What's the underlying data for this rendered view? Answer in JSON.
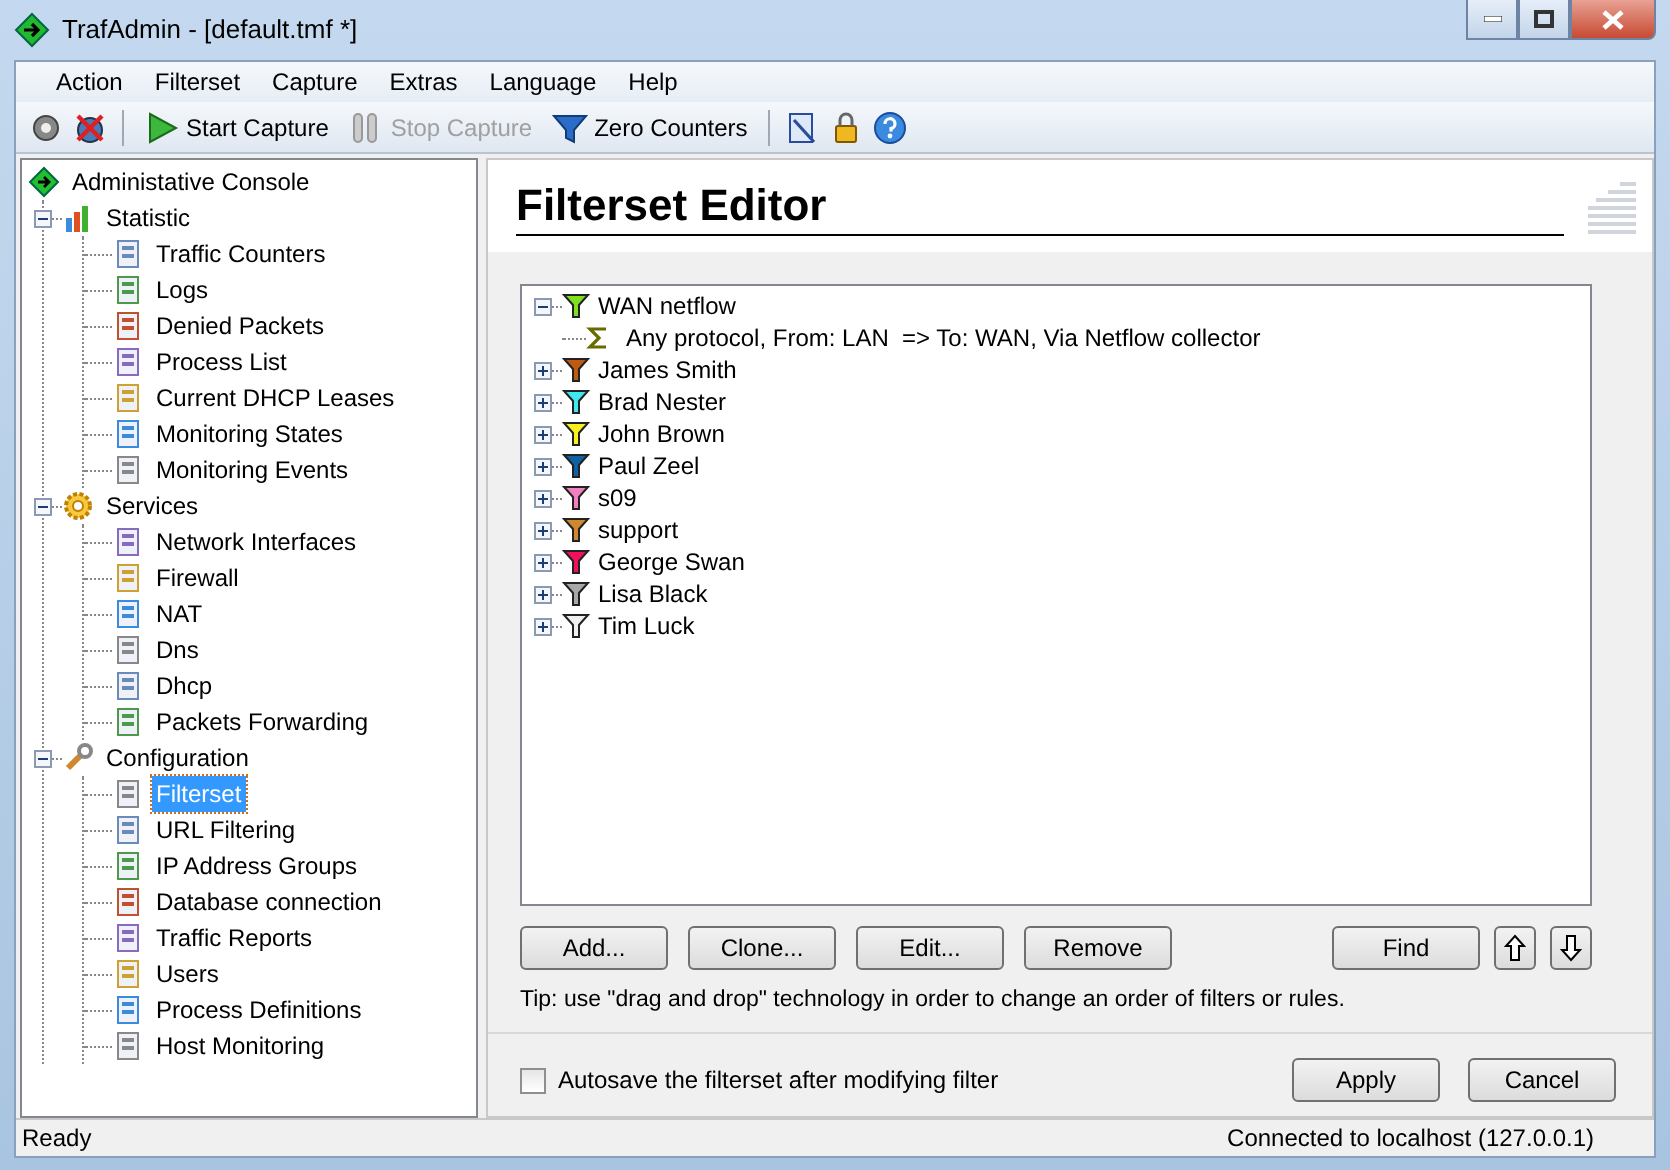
{
  "window": {
    "title": "TrafAdmin - [default.tmf *]"
  },
  "menu": [
    "Action",
    "Filterset",
    "Capture",
    "Extras",
    "Language",
    "Help"
  ],
  "toolbar": [
    {
      "label": "Start Capture",
      "disabled": false
    },
    {
      "label": "Stop Capture",
      "disabled": true
    },
    {
      "label": "Zero Counters",
      "disabled": false
    }
  ],
  "sidebar": {
    "root": "Administative Console",
    "groups": [
      {
        "label": "Statistic",
        "expanded": true,
        "children": [
          {
            "label": "Traffic Counters",
            "selected": false
          },
          {
            "label": "Logs",
            "selected": false
          },
          {
            "label": "Denied Packets",
            "selected": false
          },
          {
            "label": "Process List",
            "selected": false
          },
          {
            "label": "Current DHCP Leases",
            "selected": false
          },
          {
            "label": "Monitoring States",
            "selected": false
          },
          {
            "label": "Monitoring Events",
            "selected": false
          }
        ]
      },
      {
        "label": "Services",
        "expanded": true,
        "children": [
          {
            "label": "Network Interfaces",
            "selected": false
          },
          {
            "label": "Firewall",
            "selected": false
          },
          {
            "label": "NAT",
            "selected": false
          },
          {
            "label": "Dns",
            "selected": false
          },
          {
            "label": "Dhcp",
            "selected": false
          },
          {
            "label": "Packets Forwarding",
            "selected": false
          }
        ]
      },
      {
        "label": "Configuration",
        "expanded": true,
        "children": [
          {
            "label": "Filterset",
            "selected": true
          },
          {
            "label": "URL Filtering",
            "selected": false
          },
          {
            "label": "IP Address Groups",
            "selected": false
          },
          {
            "label": "Database connection",
            "selected": false
          },
          {
            "label": "Traffic Reports",
            "selected": false
          },
          {
            "label": "Users",
            "selected": false
          },
          {
            "label": "Process Definitions",
            "selected": false
          },
          {
            "label": "Host Monitoring",
            "selected": false
          }
        ]
      }
    ]
  },
  "editor": {
    "title": "Filterset Editor",
    "filters": [
      {
        "label": "WAN netflow",
        "color": "#80e020",
        "expanded": true,
        "children": [
          {
            "label": "Any protocol, From: LAN  => To: WAN, Via Netflow collector"
          }
        ]
      },
      {
        "label": "James Smith",
        "color": "#c05a10",
        "expanded": false
      },
      {
        "label": "Brad Nester",
        "color": "#40e8f0",
        "expanded": false
      },
      {
        "label": "John Brown",
        "color": "#f8f020",
        "expanded": false
      },
      {
        "label": "Paul Zeel",
        "color": "#1060a8",
        "expanded": false
      },
      {
        "label": "s09",
        "color": "#f080c0",
        "expanded": false
      },
      {
        "label": "support",
        "color": "#d08830",
        "expanded": false
      },
      {
        "label": "George Swan",
        "color": "#f01060",
        "expanded": false
      },
      {
        "label": "Lisa Black",
        "color": "#a8a8a8",
        "expanded": false
      },
      {
        "label": "Tim Luck",
        "color": "#f0f0f0",
        "expanded": false
      }
    ],
    "buttons": [
      "Add...",
      "Clone...",
      "Edit...",
      "Remove"
    ],
    "find": "Find",
    "tip": "Tip: use \"drag and drop\" technology in order to change an order of filters or rules.",
    "autosave": {
      "label": "Autosave the filterset after modifying filter",
      "checked": false
    },
    "dialog_buttons": [
      "Apply",
      "Cancel"
    ]
  },
  "status_bar": {
    "left": "Ready",
    "right": "Connected to localhost (127.0.0.1)"
  }
}
